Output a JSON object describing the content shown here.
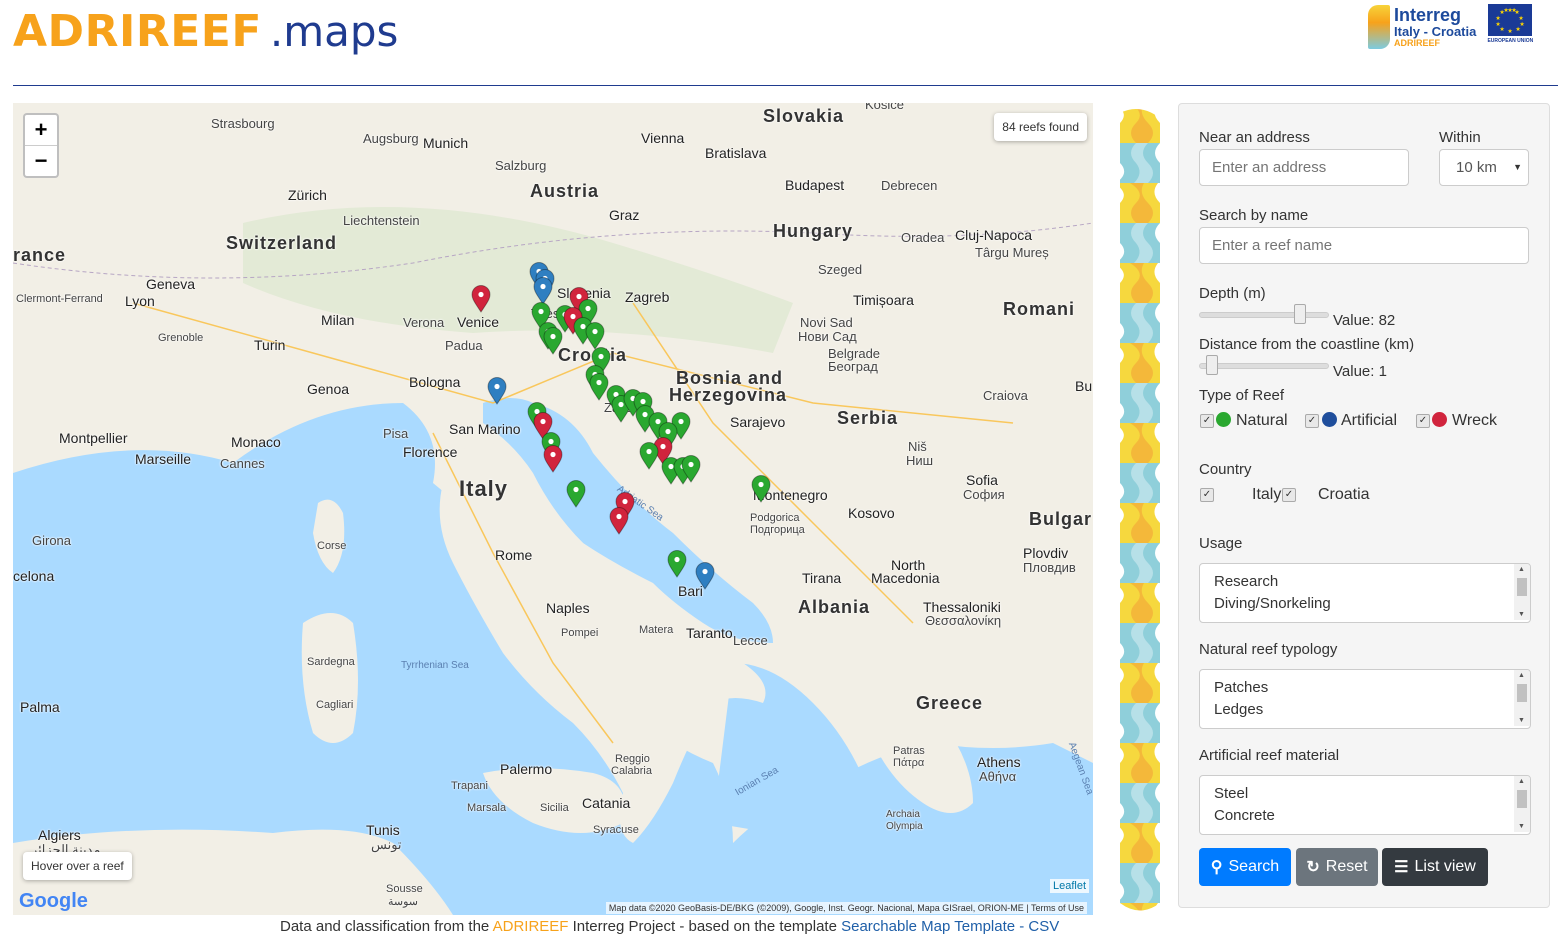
{
  "header": {
    "brand_main": "ADRIREEF",
    "brand_sub": ".maps",
    "logo_line1": "Interreg",
    "logo_line2": "Italy - Croatia",
    "logo_line3": "ADRIREEF",
    "logo_eu": "EUROPEAN UNION"
  },
  "map": {
    "zoom_in": "+",
    "zoom_out": "−",
    "reefs_found": "84 reefs found",
    "hover_hint": "Hover over a reef",
    "google": "Google",
    "leaflet": "Leaflet",
    "attribution": "Map data ©2020 GeoBasis-DE/BKG (©2009), Google, Inst. Geogr. Nacional, Mapa GISrael, ORION-ME | Terms of Use",
    "colors": {
      "natural": "#2aa830",
      "artificial": "#2f7fc1",
      "wreck": "#d1243d",
      "sea": "#aadaff",
      "land": "#f2efe6"
    },
    "labels": {
      "strasbourg": "Strasbourg",
      "augsburg": "Augsburg",
      "munich": "Munich",
      "vienna": "Vienna",
      "bratislava": "Bratislava",
      "slovakia": "Slovakia",
      "kosice": "Košice",
      "salzburg": "Salzburg",
      "austria": "Austria",
      "budapest": "Budapest",
      "debrecen": "Debrecen",
      "zurich": "Zürich",
      "liechtenstein": "Liechtenstein",
      "graz": "Graz",
      "switzerland": "Switzerland",
      "hungary": "Hungary",
      "oradea": "Oradea",
      "clujnapoca": "Cluj-Napoca",
      "targumures": "Târgu Mureș",
      "france": "rance",
      "geneva": "Geneva",
      "lyon": "Lyon",
      "clermont": "Clermont-Ferrand",
      "slovenia": "Slovenia",
      "zagreb": "Zagreb",
      "szeged": "Szeged",
      "timisoara": "Timișoara",
      "romania": "Romani",
      "milan": "Milan",
      "verona": "Verona",
      "venice": "Venice",
      "trieste": "Trieste",
      "croatia": "Croatia",
      "novisad": "Novi Sad",
      "novisad_cyr": "Нови Сад",
      "grenoble": "Grenoble",
      "turin": "Turin",
      "padua": "Padua",
      "belgrade": "Belgrade",
      "belgrade_cyr": "Београд",
      "bosnia": "Bosnia and",
      "herzegovina": "Herzegovina",
      "genoa": "Genoa",
      "bologna": "Bologna",
      "zadar": "Zadar",
      "craiova": "Craiova",
      "bu": "Bu",
      "sanmarino": "San Marino",
      "sarajevo": "Sarajevo",
      "serbia": "Serbia",
      "montpellier": "Montpellier",
      "monaco": "Monaco",
      "pisa": "Pisa",
      "marseille": "Marseille",
      "cannes": "Cannes",
      "florence": "Florence",
      "nis": "Niš",
      "nis_cyr": "Ниш",
      "italy": "Italy",
      "montenegro": "Montenegro",
      "sofia": "Sofia",
      "sofia_cyr": "София",
      "kosovo": "Kosovo",
      "girona": "Girona",
      "corse": "Corse",
      "podgorica": "Podgorica",
      "podgorica_cyr": "Подгорица",
      "bulgaria": "Bulgar",
      "rome": "Rome",
      "northmacedonia1": "North",
      "northmacedonia2": "Macedonia",
      "plovdiv": "Plovdiv",
      "plovdiv_cyr": "Пловдив",
      "barcelona": "celona",
      "tirana": "Tirana",
      "albania": "Albania",
      "naples": "Naples",
      "bari": "Bari",
      "thessaloniki": "Thessaloniki",
      "thessaloniki_cyr": "Θεσσαλονίκη",
      "pompei": "Pompei",
      "matera": "Matera",
      "taranto": "Taranto",
      "lecce": "Lecce",
      "sardegna": "Sardegna",
      "tyrrhenian": "Tyrrhenian Sea",
      "palma": "Palma",
      "cagliari": "Cagliari",
      "greece": "Greece",
      "reggio1": "Reggio",
      "reggio2": "Calabria",
      "palermo": "Palermo",
      "patras": "Patras",
      "patras_cyr": "Πάτρα",
      "athens": "Athens",
      "athens_cyr": "Αθήνα",
      "trapani": "Trapani",
      "ionian": "Ionian Sea",
      "sicilia": "Sicilia",
      "catania": "Catania",
      "marsala": "Marsala",
      "syracuse": "Syracuse",
      "algiers": "Algiers",
      "algiers_ar": "مدينة الجزائر",
      "tunis": "Tunis",
      "tunis_ar": "تونس",
      "sousse": "Sousse",
      "sousse_ar": "سوسة",
      "archaia": "Archaia",
      "olympia": "Olympia",
      "adriatic": "Adriatic Sea",
      "aegean": "Aegean Sea"
    }
  },
  "filters": {
    "near_address_label": "Near an address",
    "address_placeholder": "Enter an address",
    "within_label": "Within",
    "within_value": "10 km",
    "search_name_label": "Search by name",
    "name_placeholder": "Enter a reef name",
    "depth_label": "Depth (m)",
    "depth_value_text": "Value: 82",
    "depth_fraction": 0.8,
    "distance_label": "Distance from the coastline (km)",
    "distance_value_text": "Value: 1",
    "distance_fraction": 0.05,
    "type_label": "Type of Reef",
    "type_natural": "Natural",
    "type_artificial": "Artificial",
    "type_wreck": "Wreck",
    "country_label": "Country",
    "country_italy": "Italy",
    "country_croatia": "Croatia",
    "usage_label": "Usage",
    "usage_items": [
      "Research",
      "Diving/Snorkeling"
    ],
    "typology_label": "Natural reef typology",
    "typology_items": [
      "Patches",
      "Ledges"
    ],
    "material_label": "Artificial reef material",
    "material_items": [
      "Steel",
      "Concrete"
    ],
    "search_button": "Search",
    "reset_button": "Reset",
    "list_button": "List view"
  },
  "footer": {
    "prefix": "Data and classification from the ",
    "project": "ADRIREEF",
    "middle": " Interreg Project - based on the template ",
    "link": "Searchable Map Template - CSV"
  }
}
